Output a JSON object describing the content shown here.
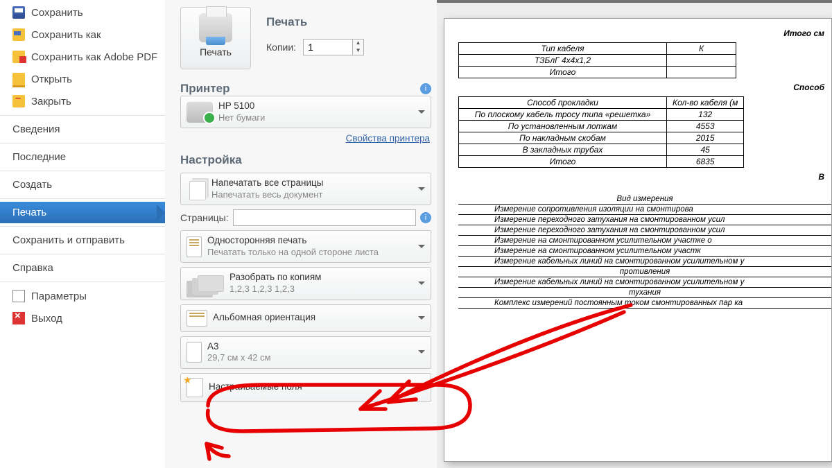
{
  "sidebar": {
    "items": [
      {
        "label": "Сохранить",
        "icon": "icon-save"
      },
      {
        "label": "Сохранить как",
        "icon": "icon-saveas"
      },
      {
        "label": "Сохранить как Adobe PDF",
        "icon": "icon-pdf"
      },
      {
        "label": "Открыть",
        "icon": "icon-open"
      },
      {
        "label": "Закрыть",
        "icon": "icon-close"
      }
    ],
    "sections": [
      "Сведения",
      "Последние",
      "Создать",
      "Печать",
      "Сохранить и отправить",
      "Справка"
    ],
    "footer": [
      {
        "label": "Параметры",
        "icon": "icon-params"
      },
      {
        "label": "Выход",
        "icon": "icon-exit"
      }
    ],
    "active_index": 3
  },
  "print": {
    "section_head": "Печать",
    "big_button": "Печать",
    "copies_label": "Копии:",
    "copies_value": "1",
    "printer_head": "Принтер",
    "printer_name": "HP 5100",
    "printer_status": "Нет бумаги",
    "printer_props": "Свойства принтера",
    "settings_head": "Настройка",
    "dd_pages": {
      "t1": "Напечатать все страницы",
      "t2": "Напечатать весь документ"
    },
    "pages_label": "Страницы:",
    "dd_sides": {
      "t1": "Односторонняя печать",
      "t2": "Печатать только на одной стороне листа"
    },
    "dd_collate": {
      "t1": "Разобрать по копиям",
      "t2": "1,2,3   1,2,3   1,2,3"
    },
    "dd_orient": {
      "t1": "Альбомная ориентация"
    },
    "dd_size": {
      "t1": "A3",
      "t2": "29,7 см x 42 см"
    },
    "dd_margins": {
      "t1": "Настраиваемые поля"
    }
  },
  "preview": {
    "h1": "Итого см",
    "t1_headers": [
      "Тип кабеля",
      "К"
    ],
    "t1_rows": [
      [
        "ТЗБлГ 4х4х1,2",
        ""
      ],
      [
        "Итого",
        ""
      ]
    ],
    "h2": "Способ",
    "t2_headers": [
      "Способ прокладки",
      "Кол-во кабеля (м"
    ],
    "t2_rows": [
      [
        "По плоскому кабель тросу типа «решетка»",
        "132"
      ],
      [
        "По установленным лоткам",
        "4553"
      ],
      [
        "По накладным скобам",
        "2015"
      ],
      [
        "В закладных трубах",
        "45"
      ],
      [
        "Итого",
        "6835"
      ]
    ],
    "h3": "В",
    "lines_title": "Вид измерения",
    "lines": [
      "Измерение сопротивления  изоляции  на  смонтирова",
      "Измерение  переходного  затухания  на  смонтированном  усил",
      "Измерение  переходного  затухания  на  смонтированном  усил",
      "Измерение  на  смонтированном  усилительном  участке  о",
      "Измерение  на  смонтированном  усилительном  участк",
      "Измерение  кабельных  линий  на  смонтированном  усилительном  у",
      "противления",
      "Измерение  кабельных  линий  на  смонтированном  усилительном  у",
      "тухания",
      "Комплекс  измерений  постоянным  током  смонтированных  пар  ка"
    ]
  }
}
